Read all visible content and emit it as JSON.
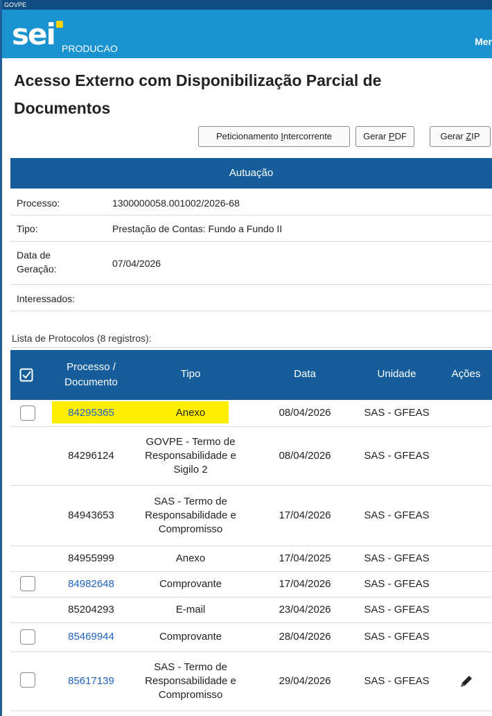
{
  "topbar": {
    "org": "GOVPE"
  },
  "header": {
    "logo": "sei",
    "env": "PRODUCAO",
    "menu": "Mer"
  },
  "page": {
    "title": "Acesso Externo com Disponibilização Parcial de Documentos"
  },
  "actions": {
    "peticionamento_pre": "Peticionamento ",
    "peticionamento_u": "I",
    "peticionamento_post": "ntercorrente",
    "gerar_pdf_pre": "Gerar ",
    "gerar_pdf_u": "P",
    "gerar_pdf_post": "DF",
    "gerar_zip_pre": "Gerar ",
    "gerar_zip_u": "Z",
    "gerar_zip_post": "IP"
  },
  "autuacao": {
    "header": "Autuação",
    "rows": [
      {
        "label": "Processo:",
        "value": "1300000058.001002/2026-68"
      },
      {
        "label": "Tipo:",
        "value": "Prestação de Contas: Fundo a Fundo II"
      },
      {
        "label": "Data de Geração:",
        "value": "07/04/2026"
      },
      {
        "label": "Interessados:",
        "value": ""
      }
    ]
  },
  "protocolos": {
    "caption": "Lista de Protocolos (8 registros):",
    "columns": [
      "Processo / Documento",
      "Tipo",
      "Data",
      "Unidade",
      "Ações"
    ],
    "rows": [
      {
        "doc": "84295365",
        "tipo": "Anexo",
        "data": "08/04/2026",
        "unidade": "SAS - GFEAS"
      },
      {
        "doc": "84296124",
        "tipo": "GOVPE - Termo de Responsabilidade e Sigilo 2",
        "data": "08/04/2026",
        "unidade": "SAS - GFEAS"
      },
      {
        "doc": "84943653",
        "tipo": "SAS - Termo de Responsabilidade e Compromisso",
        "data": "17/04/2026",
        "unidade": "SAS - GFEAS"
      },
      {
        "doc": "84955999",
        "tipo": "Anexo",
        "data": "17/04/2025",
        "unidade": "SAS - GFEAS"
      },
      {
        "doc": "84982648",
        "tipo": "Comprovante",
        "data": "17/04/2026",
        "unidade": "SAS - GFEAS"
      },
      {
        "doc": "85204293",
        "tipo": "E-mail",
        "data": "23/04/2026",
        "unidade": "SAS - GFEAS"
      },
      {
        "doc": "85469944",
        "tipo": "Comprovante",
        "data": "28/04/2026",
        "unidade": "SAS - GFEAS"
      },
      {
        "doc": "85617139",
        "tipo": "SAS - Termo de Responsabilidade e Compromisso",
        "data": "29/04/2026",
        "unidade": "SAS - GFEAS"
      }
    ]
  },
  "colors": {
    "header_blue": "#1a93d0",
    "table_blue": "#155e9b",
    "link_blue": "#1c63c4",
    "highlight": "#ffee00"
  }
}
